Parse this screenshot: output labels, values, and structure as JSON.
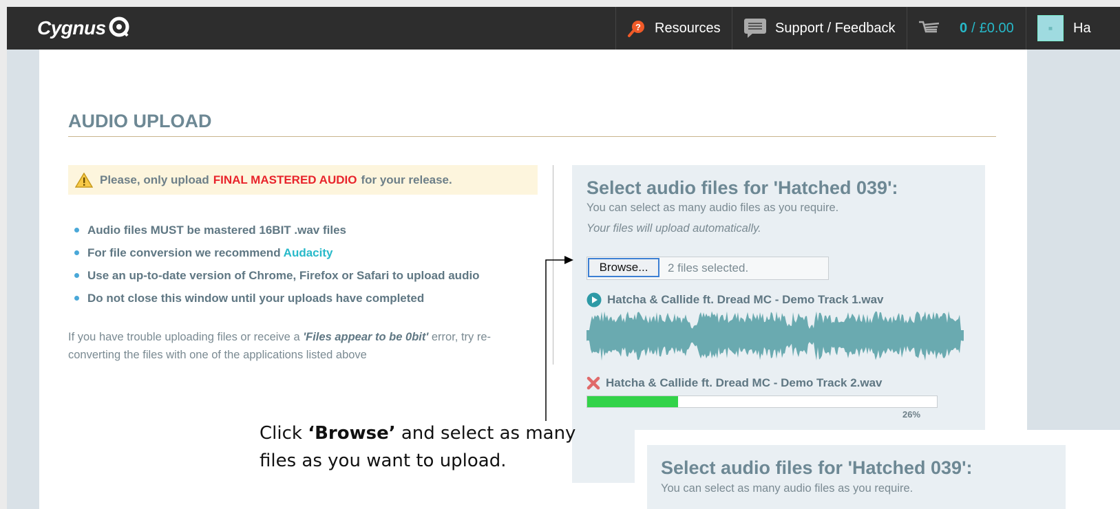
{
  "header": {
    "logo_text": "Cygnus",
    "nav": {
      "resources": "Resources",
      "support": "Support / Feedback",
      "cart_count": "0",
      "cart_total": "£0.00",
      "user_label": "Ha"
    },
    "colors": {
      "bar": "#2d2d2d",
      "accent": "#27b9c9"
    }
  },
  "page": {
    "title": "AUDIO UPLOAD",
    "warning": {
      "prefix": "Please, only upload",
      "highlight": "FINAL MASTERED AUDIO",
      "suffix": "for your release."
    },
    "guidelines": [
      {
        "text": "Audio files MUST be mastered 16BIT .wav files"
      },
      {
        "text": "For file conversion we recommend",
        "link": "Audacity"
      },
      {
        "text": "Use an up-to-date version of Chrome, Firefox or Safari to upload audio"
      },
      {
        "text": "Do not close this window until your uploads have completed"
      }
    ],
    "note": {
      "before": "If you have trouble uploading files or receive a",
      "emphasis": "'Files appear to be 0bit'",
      "after": "error, try re-converting the files with one of the applications listed above"
    }
  },
  "upload_panel": {
    "title": "Select audio files for 'Hatched 039':",
    "subtitle": "You can select as many audio files as you require.",
    "auto_note": "Your files will upload automatically.",
    "browse_label": "Browse...",
    "file_status": "2 files selected.",
    "tracks": [
      {
        "name": "Hatcha & Callide ft. Dread MC - Demo Track 1.wav",
        "status": "uploaded",
        "icon": "play-icon"
      },
      {
        "name": "Hatcha & Callide ft. Dread MC - Demo Track 2.wav",
        "status": "uploading",
        "icon": "remove-icon",
        "progress": 0.26,
        "progress_label": "26%"
      }
    ]
  },
  "annotation": {
    "prefix": "Click",
    "emphasis": "‘Browse’",
    "suffix": "and select as many files as you want to upload."
  },
  "overlay_panel": {
    "title": "Select audio files for 'Hatched 039':",
    "subtitle": "You can select as many audio files as you require."
  }
}
